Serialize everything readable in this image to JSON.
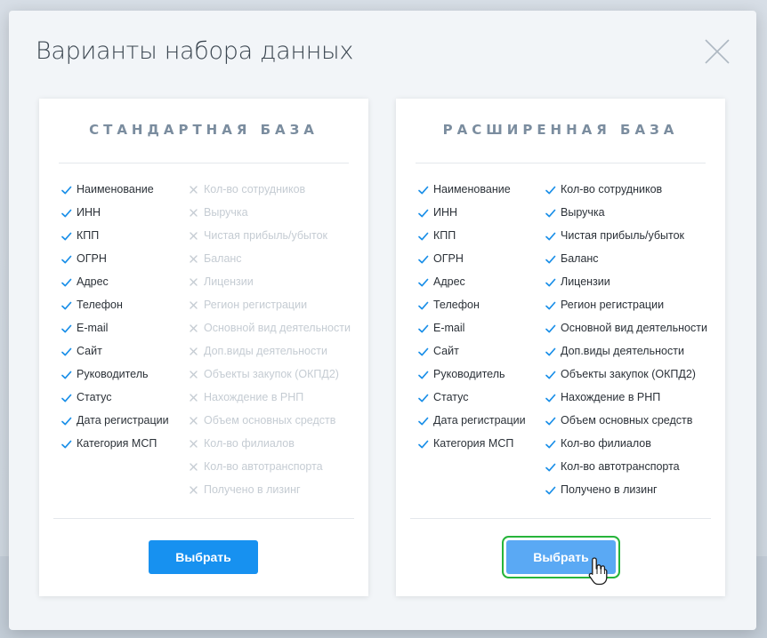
{
  "modal": {
    "title": "Варианты набора данных"
  },
  "standard": {
    "title": "СТАНДАРТНАЯ БАЗА",
    "button": "Выбрать",
    "included": [
      "Наименование",
      "ИНН",
      "КПП",
      "ОГРН",
      "Адрес",
      "Телефон",
      "E-mail",
      "Сайт",
      "Руководитель",
      "Статус",
      "Дата регистрации",
      "Категория МСП"
    ],
    "excluded": [
      "Кол-во сотрудников",
      "Выручка",
      "Чистая прибыль/убыток",
      "Баланс",
      "Лицензии",
      "Регион регистрации",
      "Основной вид деятельности",
      "Доп.виды деятельности",
      "Объекты закупок (ОКПД2)",
      "Нахождение в РНП",
      "Объем основных средств",
      "Кол-во филиалов",
      "Кол-во автотранспорта",
      "Получено в лизинг"
    ]
  },
  "extended": {
    "title": "РАСШИРЕННАЯ БАЗА",
    "button": "Выбрать",
    "included_left": [
      "Наименование",
      "ИНН",
      "КПП",
      "ОГРН",
      "Адрес",
      "Телефон",
      "E-mail",
      "Сайт",
      "Руководитель",
      "Статус",
      "Дата регистрации",
      "Категория МСП"
    ],
    "included_right": [
      "Кол-во сотрудников",
      "Выручка",
      "Чистая прибыль/убыток",
      "Баланс",
      "Лицензии",
      "Регион регистрации",
      "Основной вид деятельности",
      "Доп.виды деятельности",
      "Объекты закупок (ОКПД2)",
      "Нахождение в РНП",
      "Объем основных средств",
      "Кол-во филиалов",
      "Кол-во автотранспорта",
      "Получено в лизинг"
    ]
  },
  "icons": {
    "included": "check-icon",
    "excluded": "cross-icon",
    "close": "close-icon",
    "cursor": "hand-pointer-icon"
  },
  "colors": {
    "check": "#1a8fe8",
    "cross": "#c5ccd3",
    "primary_button": "#1791f0",
    "hover_button": "#5aa9f4",
    "highlight": "#27b43b"
  }
}
